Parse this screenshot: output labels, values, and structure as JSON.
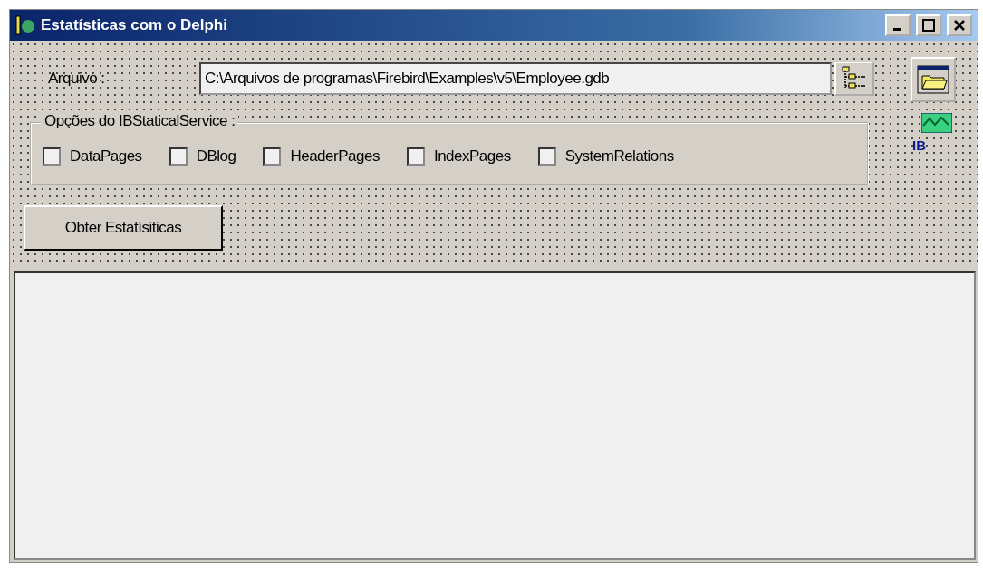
{
  "window": {
    "title": "Estatísticas com o Delphi"
  },
  "file": {
    "label": "Arquivo :",
    "value": "C:\\Arquivos de programas\\Firebird\\Examples\\v5\\Employee.gdb"
  },
  "options": {
    "title": "Opções  do IBStaticalService :",
    "items": [
      {
        "label": "DataPages",
        "checked": false
      },
      {
        "label": "DBlog",
        "checked": false
      },
      {
        "label": "HeaderPages",
        "checked": false
      },
      {
        "label": "IndexPages",
        "checked": false
      },
      {
        "label": "SystemRelations",
        "checked": false
      }
    ]
  },
  "button": {
    "label": "Obter Estatísiticas"
  },
  "ib_icon": {
    "label": "IB"
  }
}
